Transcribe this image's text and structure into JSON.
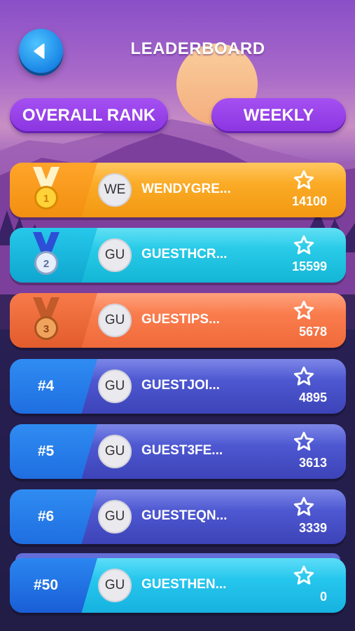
{
  "header": {
    "title": "LEADERBOARD"
  },
  "tabs": {
    "overall_label": "OVERALL RANK",
    "weekly_label": "WEEKLY",
    "active": "weekly"
  },
  "rows": [
    {
      "rank": "1",
      "medal": "gold-medal",
      "avatar": "WE",
      "name": "WENDYGRE...",
      "score": "14100"
    },
    {
      "rank": "2",
      "medal": "silver-medal",
      "avatar": "GU",
      "name": "GUESTHCR...",
      "score": "15599"
    },
    {
      "rank": "3",
      "medal": "bronze-medal",
      "avatar": "GU",
      "name": "GUESTIPS...",
      "score": "5678"
    },
    {
      "rank": "#4",
      "avatar": "GU",
      "name": "GUESTJOI...",
      "score": "4895"
    },
    {
      "rank": "#5",
      "avatar": "GU",
      "name": "GUEST3FE...",
      "score": "3613"
    },
    {
      "rank": "#6",
      "avatar": "GU",
      "name": "GUESTEQN...",
      "score": "3339"
    }
  ],
  "current_player": {
    "rank": "#50",
    "avatar": "GU",
    "name": "GUESTHEN...",
    "score": "0"
  },
  "colors": {
    "gold": "#f7a21c",
    "silver_row": "#1fc3e4",
    "bronze_row": "#f2703f",
    "regular_row": "#4a52cc",
    "rank_badge": "#2483ee",
    "tab": "#9541e8"
  }
}
